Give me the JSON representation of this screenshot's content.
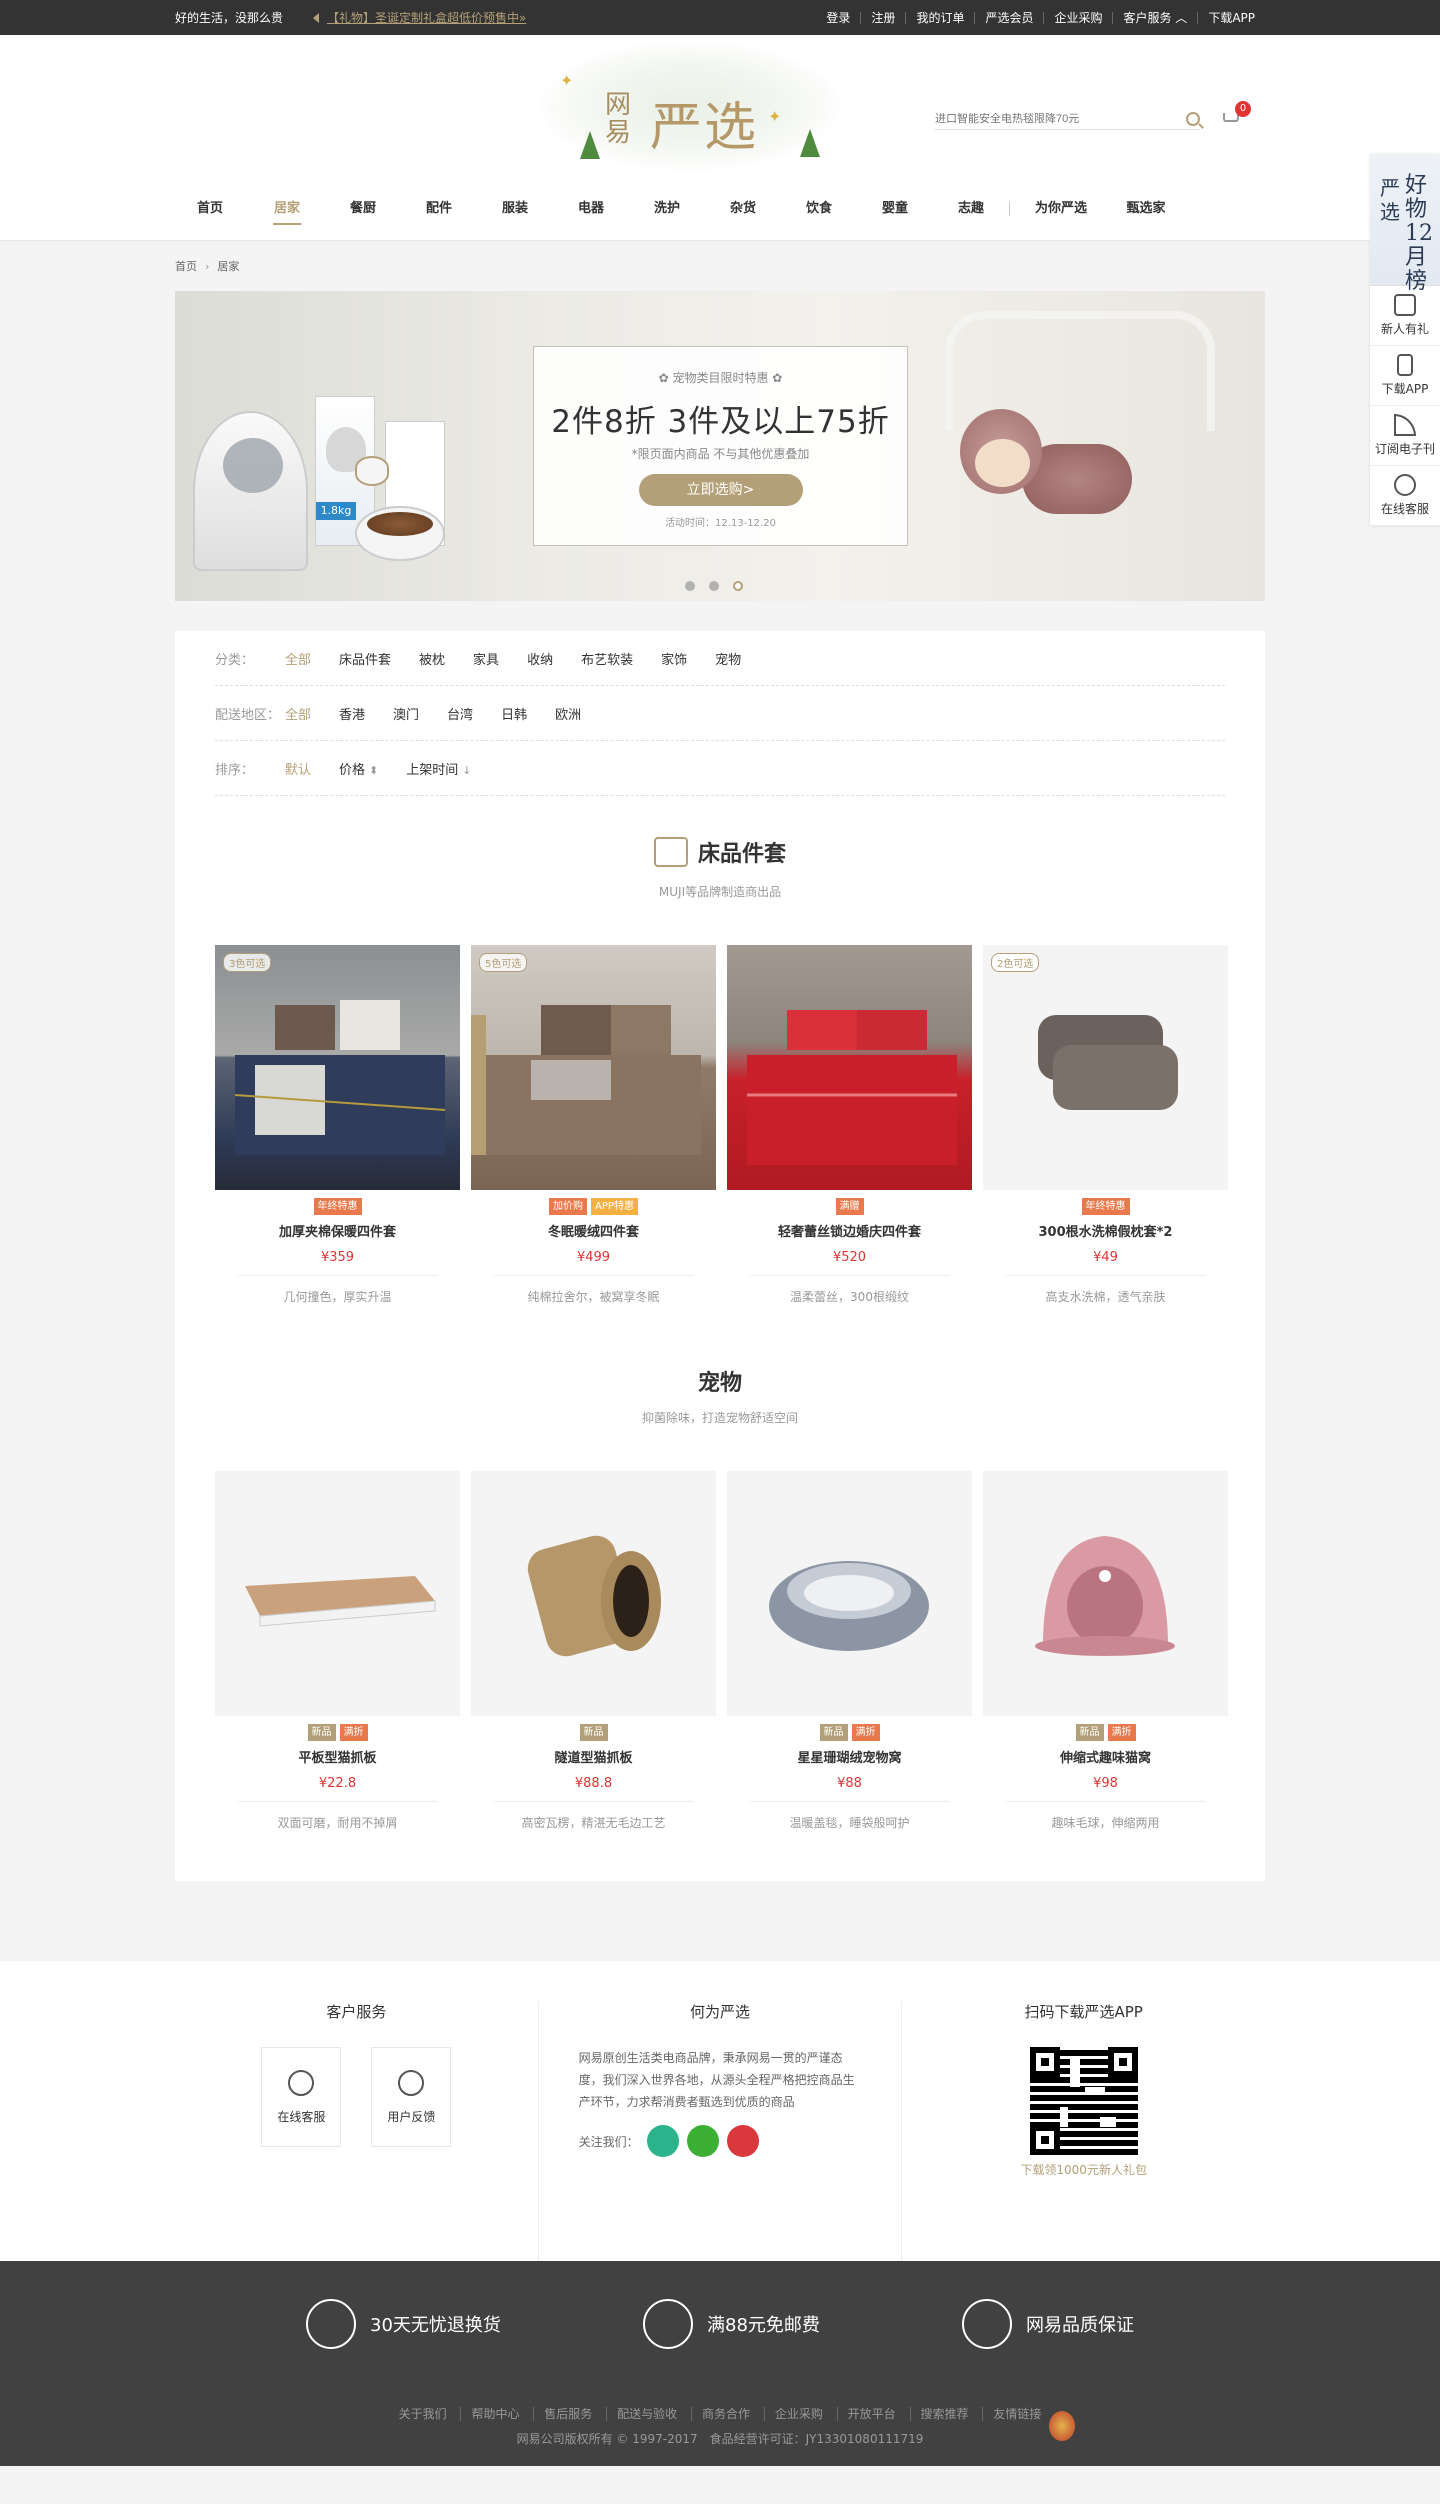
{
  "topbar": {
    "slogan": "好的生活，没那么贵",
    "notice": "【礼物】圣诞定制礼盒超低价预售中»",
    "links": [
      "登录",
      "注册",
      "我的订单",
      "严选会员",
      "企业采购",
      "客户服务 ︿",
      "下载APP"
    ]
  },
  "logo": {
    "wy": "网易",
    "yx": "严选"
  },
  "search": {
    "placeholder": "进口智能安全电热毯限降70元"
  },
  "cart": {
    "count": "0"
  },
  "nav": {
    "items": [
      "首页",
      "居家",
      "餐厨",
      "配件",
      "服装",
      "电器",
      "洗护",
      "杂货",
      "饮食",
      "婴童",
      "志趣"
    ],
    "extra": [
      "为你严选",
      "甄选家"
    ]
  },
  "side": {
    "best_a": "好物12月榜",
    "best_b": "严选",
    "items": [
      "新人有礼",
      "下载APP",
      "订阅电子刊",
      "在线客服"
    ]
  },
  "breadcrumb": {
    "home": "首页",
    "current": "居家"
  },
  "banner": {
    "small": "✿ 宠物类目限时特惠 ✿",
    "big": "2件8折 3件及以上75折",
    "note": "*限页面内商品 不与其他优惠叠加",
    "button": "立即选购>",
    "date": "活动时间：12.13-12.20",
    "bag_label": "1.8kg",
    "active_dot": 3
  },
  "filters": {
    "category_label": "分类：",
    "categories": [
      "全部",
      "床品件套",
      "被枕",
      "家具",
      "收纳",
      "布艺软装",
      "家饰",
      "宠物"
    ],
    "region_label": "配送地区：",
    "regions": [
      "全部",
      "香港",
      "澳门",
      "台湾",
      "日韩",
      "欧洲"
    ],
    "sort_label": "排序：",
    "sorts": [
      "默认",
      "价格",
      "上架时间"
    ]
  },
  "sections": [
    {
      "title": "床品件套",
      "sub": "MUJI等品牌制造商出品",
      "products": [
        {
          "tag": "3色可选",
          "badges": [
            "年终特惠"
          ],
          "name": "加厚夹棉保暖四件套",
          "price": "¥359",
          "desc": "几何撞色，厚实升温"
        },
        {
          "tag": "5色可选",
          "badges": [
            "加价购",
            "APP特惠"
          ],
          "name": "冬眠暖绒四件套",
          "price": "¥499",
          "desc": "纯棉拉舍尔，被窝享冬眠"
        },
        {
          "tag": "",
          "badges": [
            "满赠"
          ],
          "name": "轻奢蕾丝锁边婚庆四件套",
          "price": "¥520",
          "desc": "温柔蕾丝，300根缎纹"
        },
        {
          "tag": "2色可选",
          "badges": [
            "年终特惠"
          ],
          "name": "300根水洗棉假枕套*2",
          "price": "¥49",
          "desc": "高支水洗棉，透气亲肤"
        }
      ]
    },
    {
      "title": "宠物",
      "sub": "抑菌除味，打造宠物舒适空间",
      "products": [
        {
          "tag": "",
          "badges": [
            "新品",
            "满折"
          ],
          "name": "平板型猫抓板",
          "price": "¥22.8",
          "desc": "双面可磨，耐用不掉屑"
        },
        {
          "tag": "",
          "badges": [
            "新品"
          ],
          "name": "隧道型猫抓板",
          "price": "¥88.8",
          "desc": "高密瓦楞，精湛无毛边工艺"
        },
        {
          "tag": "",
          "badges": [
            "新品",
            "满折"
          ],
          "name": "星星珊瑚绒宠物窝",
          "price": "¥88",
          "desc": "温暖盖毯，睡袋般呵护"
        },
        {
          "tag": "",
          "badges": [
            "新品",
            "满折"
          ],
          "name": "伸缩式趣味猫窝",
          "price": "¥98",
          "desc": "趣味毛球，伸缩两用"
        }
      ]
    }
  ],
  "footer": {
    "service_title": "客户服务",
    "service_btns": [
      "在线客服",
      "用户反馈"
    ],
    "about_title": "何为严选",
    "about_text": "网易原创生活类电商品牌，秉承网易一贯的严谨态度，我们深入世界各地，从源头全程严格把控商品生产环节，力求帮消费者甄选到优质的商品",
    "follow": "关注我们：",
    "app_title": "扫码下载严选APP",
    "app_note": "下载领1000元新人礼包",
    "guarantees": [
      "30天无忧退换货",
      "满88元免邮费",
      "网易品质保证"
    ],
    "links": [
      "关于我们",
      "帮助中心",
      "售后服务",
      "配送与验收",
      "商务合作",
      "企业采购",
      "开放平台",
      "搜索推荐",
      "友情链接"
    ],
    "copyright": "网易公司版权所有 © 1997-2017　食品经营许可证：JY13301080111719"
  },
  "colors": {
    "accent": "#b4a078",
    "price": "#e23333",
    "badge": "#e8794c",
    "topbar": "#333333",
    "footer": "#414141"
  }
}
